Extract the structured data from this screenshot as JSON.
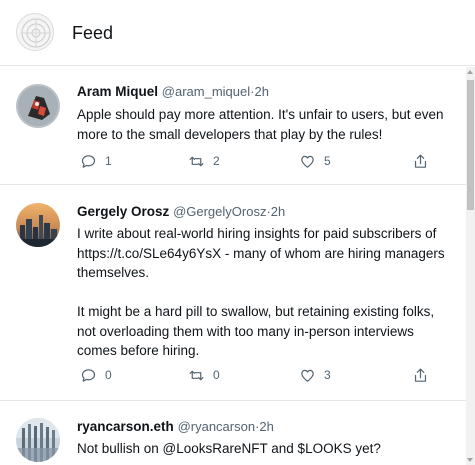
{
  "header": {
    "title": "Feed"
  },
  "tweets": [
    {
      "name": "Aram Miquel",
      "handle": "@aram_miquel",
      "separator": "·",
      "time": "2h",
      "text": "Apple should pay more attention. It's unfair to users, but even more to the small developers that play by the rules!",
      "replies": "1",
      "retweets": "2",
      "likes": "5"
    },
    {
      "name": "Gergely Orosz",
      "handle": "@GergelyOrosz",
      "separator": "·",
      "time": "2h",
      "text": "I write about real-world hiring insights for paid subscribers of https://t.co/SLe64y6YsX - many of whom are hiring managers themselves.\n\nIt might be a hard pill to swallow, but retaining existing folks, not overloading them with too many in-person interviews comes before hiring.",
      "replies": "0",
      "retweets": "0",
      "likes": "3"
    },
    {
      "name": "ryancarson.eth",
      "handle": "@ryancarson",
      "separator": "·",
      "time": "2h",
      "text": "Not bullish on @LooksRareNFT and $LOOKS yet?"
    }
  ],
  "icons": {
    "reply": "reply-icon",
    "retweet": "retweet-icon",
    "like": "heart-icon",
    "share": "share-icon"
  },
  "colors": {
    "text": "#0f1419",
    "muted": "#536471",
    "divider": "#e6e6e6"
  }
}
